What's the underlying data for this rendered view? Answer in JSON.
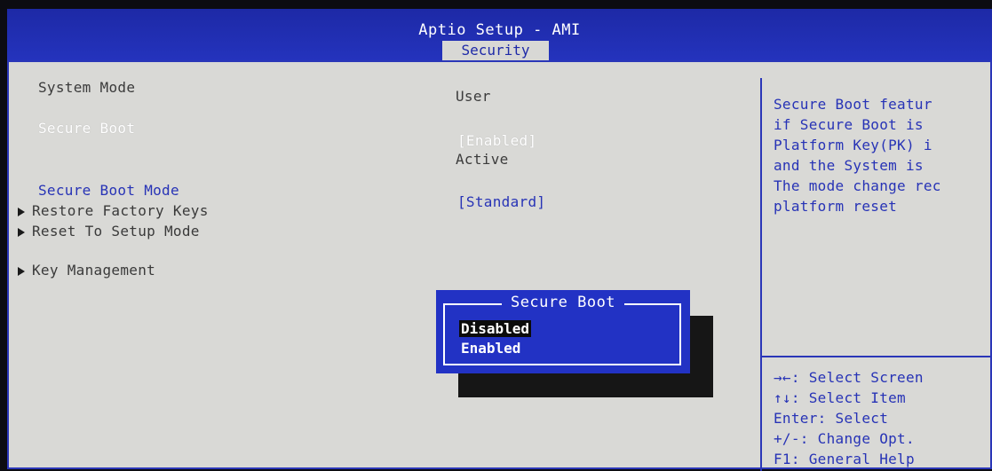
{
  "header": {
    "title": "Aptio Setup - AMI"
  },
  "tabs": [
    {
      "label": "Security",
      "active": true
    }
  ],
  "settings": {
    "system_mode": {
      "label": "System Mode",
      "value": "User"
    },
    "secure_boot": {
      "label": "Secure Boot",
      "value": "[Enabled]",
      "status": "Active"
    },
    "secure_boot_mode": {
      "label": "Secure Boot Mode",
      "value": "[Standard]"
    },
    "restore_factory_keys": {
      "label": "Restore Factory Keys"
    },
    "reset_to_setup_mode": {
      "label": "Reset To Setup Mode"
    },
    "key_management": {
      "label": "Key Management"
    }
  },
  "help": {
    "lines": [
      "Secure Boot featur",
      "if Secure Boot is ",
      "Platform Key(PK) i",
      "and the System is ",
      "The mode change rec",
      "platform reset"
    ],
    "keys": [
      "→←: Select Screen",
      "↑↓: Select Item",
      "Enter: Select",
      "+/-: Change Opt.",
      "F1: General Help"
    ]
  },
  "popup": {
    "title": "Secure Boot",
    "options": [
      "Disabled",
      "Enabled"
    ],
    "highlighted": "Disabled"
  },
  "colors": {
    "header_blue": "#2433bd",
    "panel_bg": "#d9d9d6",
    "text_blue": "#2733b6",
    "popup_blue": "#2232c4"
  }
}
